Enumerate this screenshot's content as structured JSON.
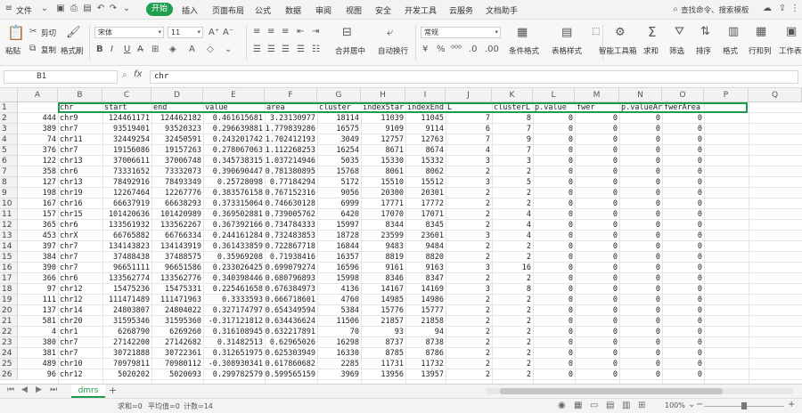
{
  "menubar": {
    "file": "文件",
    "tabs": [
      "开始",
      "插入",
      "页面布局",
      "公式",
      "数据",
      "审阅",
      "视图",
      "安全",
      "开发工具",
      "云服务",
      "文档助手"
    ],
    "search": "查找命令、搜索模板"
  },
  "ribbon": {
    "cut": "剪切",
    "copy": "复制",
    "format_painter": "格式刷",
    "paste": "粘贴",
    "font_name": "宋体",
    "font_size": "11",
    "merge_center": "合并居中",
    "wrap_text": "自动换行",
    "number_format": "常规",
    "conditional_format": "条件格式",
    "table_style": "表格样式",
    "smart_toolbox": "智能工具箱",
    "sum": "求和",
    "filter": "筛选",
    "sort": "排序",
    "format": "格式",
    "rows_cols": "行和列",
    "worksheet": "工作表"
  },
  "formula": {
    "cell_ref": "B1",
    "fx": "fx",
    "content": "chr"
  },
  "grid": {
    "columns": [
      "A",
      "B",
      "C",
      "D",
      "E",
      "F",
      "G",
      "H",
      "I",
      "J",
      "K",
      "L",
      "M",
      "N",
      "O",
      "P",
      "Q"
    ],
    "header": [
      "",
      "chr",
      "start",
      "end",
      "value",
      "area",
      "cluster",
      "indexStar",
      "indexEnd",
      "L",
      "clusterL",
      "p.value",
      "fwer",
      "p.valueAr",
      "fwerArea",
      "",
      ""
    ],
    "rows": [
      [
        "444",
        "chr9",
        "124461171",
        "124462182",
        "0.461615681",
        "3.23130977",
        "18114",
        "11039",
        "11045",
        "7",
        "8",
        "0",
        "0",
        "0",
        "0"
      ],
      [
        "389",
        "chr7",
        "93519401",
        "93520323",
        "0.296639881",
        "1.779839286",
        "16575",
        "9109",
        "9114",
        "6",
        "7",
        "0",
        "0",
        "0",
        "0"
      ],
      [
        "74",
        "chr11",
        "32449254",
        "32450591",
        "0.243201742",
        "1.702412193",
        "3049",
        "12757",
        "12763",
        "7",
        "9",
        "0",
        "0",
        "0",
        "0"
      ],
      [
        "376",
        "chr7",
        "19156086",
        "19157263",
        "0.278067063",
        "1.112268253",
        "16254",
        "8671",
        "8674",
        "4",
        "7",
        "0",
        "0",
        "0",
        "0"
      ],
      [
        "122",
        "chr13",
        "37006611",
        "37006748",
        "0.345738315",
        "1.037214946",
        "5035",
        "15330",
        "15332",
        "3",
        "3",
        "0",
        "0",
        "0",
        "0"
      ],
      [
        "358",
        "chr6",
        "73331652",
        "73332073",
        "0.390690447",
        "0.781380895",
        "15768",
        "8061",
        "8062",
        "2",
        "2",
        "0",
        "0",
        "0",
        "0"
      ],
      [
        "127",
        "chr13",
        "78492916",
        "78493349",
        "0.25728098",
        "0.77184294",
        "5172",
        "15510",
        "15512",
        "3",
        "5",
        "0",
        "0",
        "0",
        "0"
      ],
      [
        "198",
        "chr19",
        "12267464",
        "12267776",
        "0.383576158",
        "0.767152316",
        "9056",
        "20300",
        "20301",
        "2",
        "2",
        "0",
        "0",
        "0",
        "0"
      ],
      [
        "167",
        "chr16",
        "66637919",
        "66638293",
        "0.373315064",
        "0.746630128",
        "6999",
        "17771",
        "17772",
        "2",
        "2",
        "0",
        "0",
        "0",
        "0"
      ],
      [
        "157",
        "chr15",
        "101420636",
        "101420989",
        "0.369502881",
        "0.739005762",
        "6420",
        "17070",
        "17071",
        "2",
        "4",
        "0",
        "0",
        "0",
        "0"
      ],
      [
        "365",
        "chr6",
        "133561932",
        "133562267",
        "0.367392166",
        "0.734784333",
        "15997",
        "8344",
        "8345",
        "2",
        "4",
        "0",
        "0",
        "0",
        "0"
      ],
      [
        "453",
        "chrX",
        "66765882",
        "66766334",
        "0.244161284",
        "0.732483853",
        "18728",
        "23599",
        "23601",
        "3",
        "4",
        "0",
        "0",
        "0",
        "0"
      ],
      [
        "397",
        "chr7",
        "134143823",
        "134143919",
        "0.361433859",
        "0.722867718",
        "16844",
        "9483",
        "9484",
        "2",
        "2",
        "0",
        "0",
        "0",
        "0"
      ],
      [
        "384",
        "chr7",
        "37488438",
        "37488575",
        "0.35969208",
        "0.71938416",
        "16357",
        "8819",
        "8820",
        "2",
        "2",
        "0",
        "0",
        "0",
        "0"
      ],
      [
        "390",
        "chr7",
        "96651111",
        "96651586",
        "0.233026425",
        "0.699079274",
        "16596",
        "9161",
        "9163",
        "3",
        "16",
        "0",
        "0",
        "0",
        "0"
      ],
      [
        "366",
        "chr6",
        "133562774",
        "133562776",
        "0.340398446",
        "0.680796893",
        "15998",
        "8346",
        "8347",
        "2",
        "2",
        "0",
        "0",
        "0",
        "0"
      ],
      [
        "97",
        "chr12",
        "15475236",
        "15475331",
        "0.225461658",
        "0.676384973",
        "4136",
        "14167",
        "14169",
        "3",
        "8",
        "0",
        "0",
        "0",
        "0"
      ],
      [
        "111",
        "chr12",
        "111471489",
        "111471963",
        "0.3333593",
        "0.666718601",
        "4760",
        "14985",
        "14986",
        "2",
        "2",
        "0",
        "0",
        "0",
        "0"
      ],
      [
        "137",
        "chr14",
        "24803807",
        "24804022",
        "0.327174797",
        "0.654349594",
        "5384",
        "15776",
        "15777",
        "2",
        "2",
        "0",
        "0",
        "0",
        "0"
      ],
      [
        "581",
        "chr20",
        "31595346",
        "31595360",
        "-0.317121812",
        "0.634436624",
        "11506",
        "21857",
        "21858",
        "2",
        "2",
        "0",
        "0",
        "0",
        "0"
      ],
      [
        "4",
        "chr1",
        "6268790",
        "6269260",
        "0.316108945",
        "0.632217891",
        "70",
        "93",
        "94",
        "2",
        "2",
        "0",
        "0",
        "0",
        "0"
      ],
      [
        "380",
        "chr7",
        "27142200",
        "27142682",
        "0.31482513",
        "0.62965026",
        "16298",
        "8737",
        "8738",
        "2",
        "2",
        "0",
        "0",
        "0",
        "0"
      ],
      [
        "381",
        "chr7",
        "30721888",
        "30722361",
        "0.312651975",
        "0.625303949",
        "16330",
        "8785",
        "8786",
        "2",
        "2",
        "0",
        "0",
        "0",
        "0"
      ],
      [
        "489",
        "chr10",
        "70979811",
        "70980112",
        "-0.308930341",
        "0.617860682",
        "2285",
        "11731",
        "11732",
        "2",
        "2",
        "0",
        "0",
        "0",
        "0"
      ],
      [
        "96",
        "chr12",
        "5020202",
        "5020693",
        "0.299782579",
        "0.599565159",
        "3969",
        "13956",
        "13957",
        "2",
        "2",
        "0",
        "0",
        "0",
        "0"
      ]
    ]
  },
  "sheets": {
    "active": "dmrs",
    "add": "+"
  },
  "status": {
    "sum": "求和=0",
    "average": "平均值=0",
    "count": "计数=14",
    "zoom": "100%"
  }
}
